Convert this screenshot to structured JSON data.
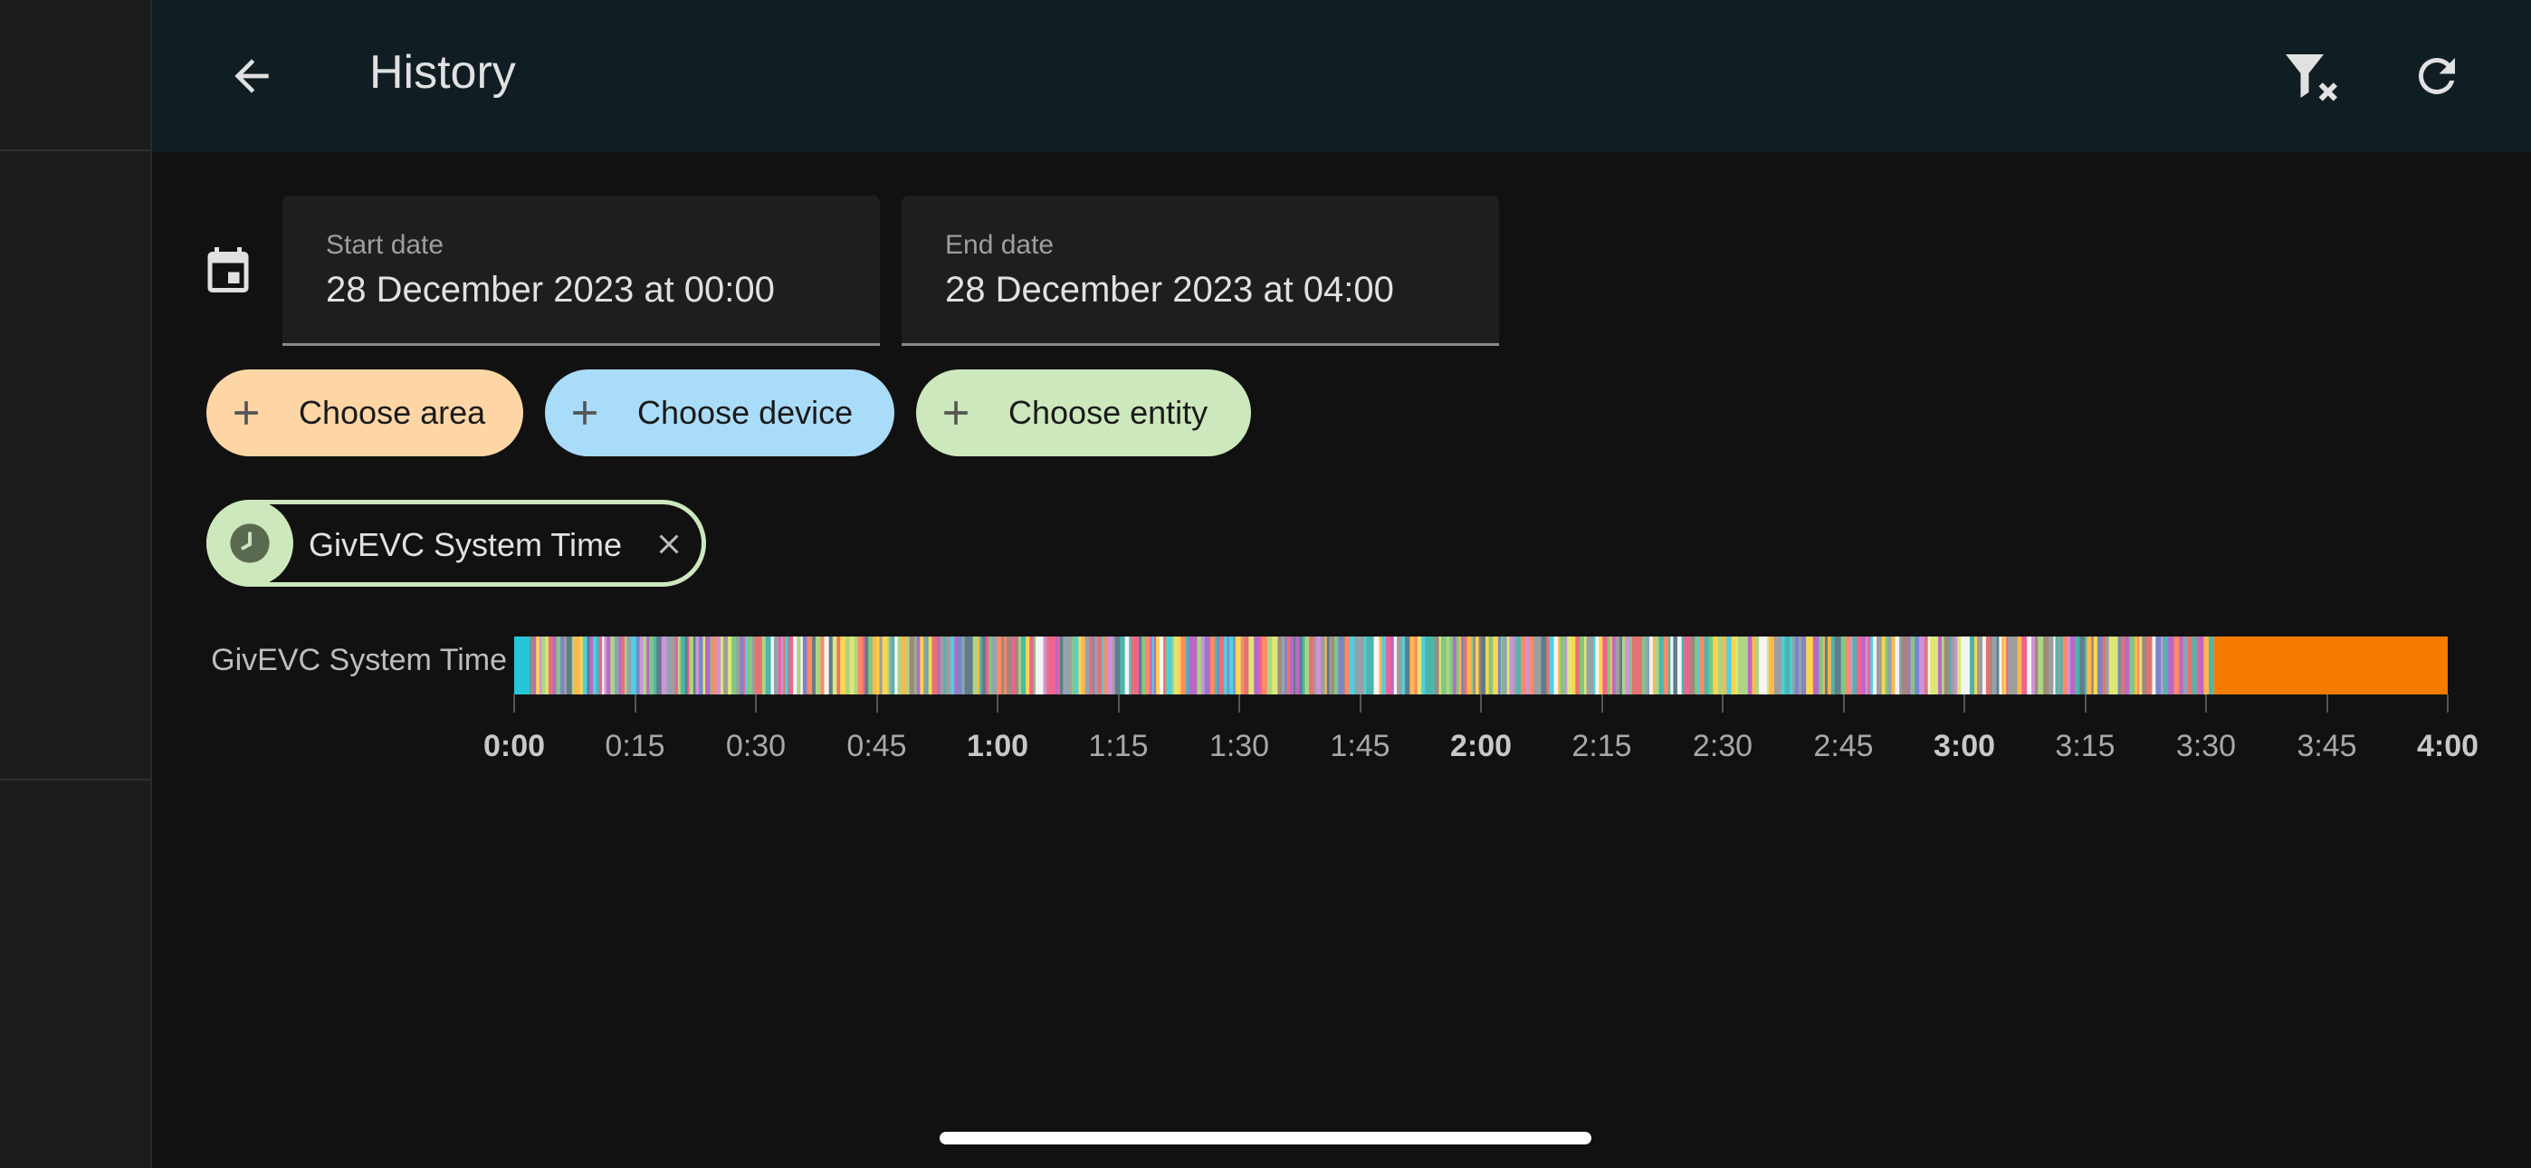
{
  "header": {
    "title": "History"
  },
  "dates": {
    "start": {
      "label": "Start date",
      "value": "28 December 2023 at 00:00"
    },
    "end": {
      "label": "End date",
      "value": "28 December 2023 at 04:00"
    }
  },
  "targets": {
    "area_label": "Choose area",
    "device_label": "Choose device",
    "entity_label": "Choose entity"
  },
  "selected_entity": {
    "name": "GivEVC System Time"
  },
  "timeline": {
    "row_label": "GivEVC System Time",
    "start": "0:00",
    "end": "4:00",
    "segments": [
      {
        "from": "0:00",
        "to": "0:02",
        "color": "#26c6da"
      },
      {
        "from": "0:02",
        "to": "3:31",
        "color": "striped"
      },
      {
        "from": "3:31",
        "to": "4:00",
        "color": "#f57c00"
      }
    ],
    "ticks": [
      {
        "label": "0:00",
        "bold": true
      },
      {
        "label": "0:15",
        "bold": false
      },
      {
        "label": "0:30",
        "bold": false
      },
      {
        "label": "0:45",
        "bold": false
      },
      {
        "label": "1:00",
        "bold": true
      },
      {
        "label": "1:15",
        "bold": false
      },
      {
        "label": "1:30",
        "bold": false
      },
      {
        "label": "1:45",
        "bold": false
      },
      {
        "label": "2:00",
        "bold": true
      },
      {
        "label": "2:15",
        "bold": false
      },
      {
        "label": "2:30",
        "bold": false
      },
      {
        "label": "2:45",
        "bold": false
      },
      {
        "label": "3:00",
        "bold": true
      },
      {
        "label": "3:15",
        "bold": false
      },
      {
        "label": "3:30",
        "bold": false
      },
      {
        "label": "3:45",
        "bold": false
      },
      {
        "label": "4:00",
        "bold": true
      }
    ]
  },
  "colors": {
    "topbar": "#101e24",
    "chip_area": "#fed6a6",
    "chip_device": "#a9dcf9",
    "chip_entity": "#cde8bc",
    "first_state": "#26c6da",
    "last_state": "#f57c00"
  },
  "icons": {
    "back": "arrow-left-icon",
    "filter_clear": "filter-remove-icon",
    "refresh": "refresh-icon",
    "calendar": "calendar-icon",
    "plus": "plus-icon",
    "clock": "clock-icon",
    "close": "close-icon"
  }
}
